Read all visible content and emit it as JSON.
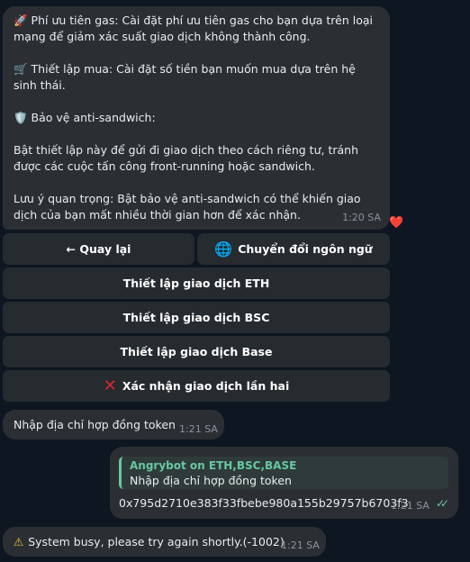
{
  "bot_message": {
    "paragraphs": [
      "🚀 Phí ưu tiên gas: Cài đặt phí ưu tiên gas cho bạn dựa trên loại mạng để giảm xác suất giao dịch không thành công.",
      "🛒 Thiết lập mua: Cài đặt số tiền bạn muốn mua dựa trên hệ sinh thái.",
      "🛡️ Bảo vệ anti-sandwich:",
      "Bật thiết lập này để gửi đi giao dịch theo cách riêng tư, tránh được các cuộc tấn công front-running hoặc sandwich.",
      "Lưu ý quan trọng: Bật bảo vệ anti-sandwich có thể khiến giao dịch của bạn mất nhiều thời gian hơn để xác nhận."
    ],
    "time": "1:20 SA",
    "reaction": "❤️"
  },
  "keyboard": {
    "back": "← Quay lại",
    "language_icon": "🌐",
    "language": "Chuyển đổi ngôn ngữ",
    "eth": "Thiết lập giao dịch ETH",
    "bsc": "Thiết lập giao dịch BSC",
    "base": "Thiết lập giao dịch Base",
    "confirm_icon": "✕",
    "confirm": "Xác nhận giao dịch lần hai"
  },
  "prompt_message": {
    "text": "Nhập địa chỉ hợp đồng token",
    "time": "1:21 SA"
  },
  "user_message": {
    "reply_name": "Angrybot on ETH,BSC,BASE",
    "reply_text": "Nhập địa chỉ hợp đồng token",
    "text": "0x795d2710e383f33fbebe980a155b29757b6703f3",
    "time": "1:21 SA",
    "status_icon": "✓✓"
  },
  "error_message": {
    "icon": "⚠",
    "text": "System busy, please try again shortly.(-1002)",
    "time": "1:21 SA"
  },
  "colors": {
    "background": "#0e1621",
    "bubble": "#2b2f33",
    "accent": "#67c7a2"
  }
}
